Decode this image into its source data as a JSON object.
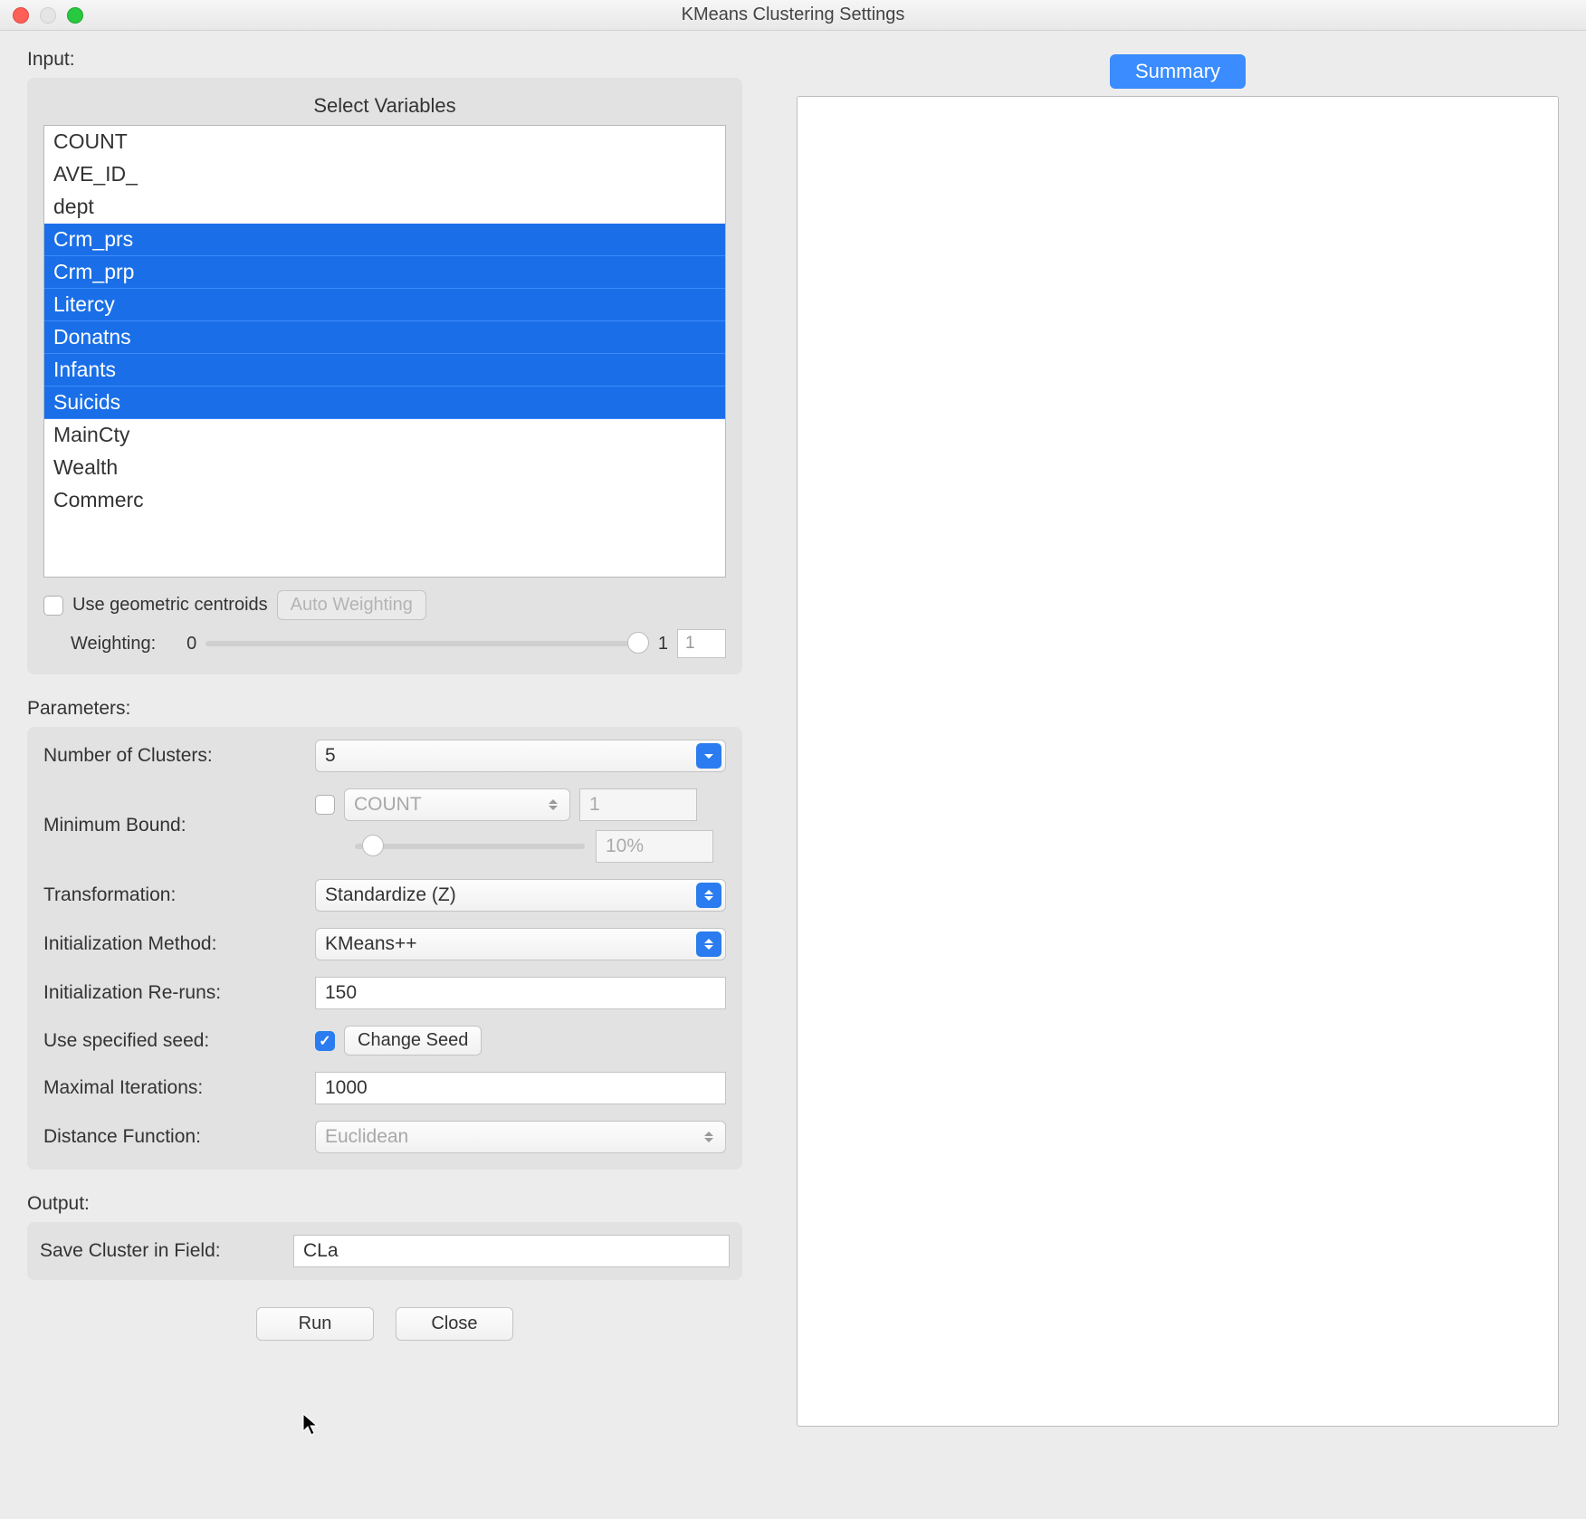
{
  "window": {
    "title": "KMeans Clustering Settings"
  },
  "input": {
    "section_label": "Input:",
    "select_header": "Select Variables",
    "variables": [
      {
        "name": "COUNT",
        "selected": false
      },
      {
        "name": "AVE_ID_",
        "selected": false
      },
      {
        "name": "dept",
        "selected": false
      },
      {
        "name": "Crm_prs",
        "selected": true
      },
      {
        "name": "Crm_prp",
        "selected": true
      },
      {
        "name": "Litercy",
        "selected": true
      },
      {
        "name": "Donatns",
        "selected": true
      },
      {
        "name": "Infants",
        "selected": true
      },
      {
        "name": "Suicids",
        "selected": true
      },
      {
        "name": "MainCty",
        "selected": false
      },
      {
        "name": "Wealth",
        "selected": false
      },
      {
        "name": "Commerc",
        "selected": false
      }
    ],
    "geometric_centroids": {
      "label": "Use geometric centroids",
      "checked": false
    },
    "auto_weighting": {
      "label": "Auto Weighting",
      "enabled": false
    },
    "weighting": {
      "label": "Weighting:",
      "min_label": "0",
      "max_label": "1",
      "value_display": "1"
    }
  },
  "parameters": {
    "section_label": "Parameters:",
    "number_of_clusters": {
      "label": "Number of Clusters:",
      "value": "5"
    },
    "minimum_bound": {
      "label": "Minimum Bound:",
      "checked": false,
      "field": "COUNT",
      "value": "1",
      "percent": "10%"
    },
    "transformation": {
      "label": "Transformation:",
      "value": "Standardize (Z)"
    },
    "init_method": {
      "label": "Initialization Method:",
      "value": "KMeans++"
    },
    "init_reruns": {
      "label": "Initialization Re-runs:",
      "value": "150"
    },
    "use_seed": {
      "label": "Use specified seed:",
      "checked": true,
      "change_seed": "Change Seed"
    },
    "max_iter": {
      "label": "Maximal Iterations:",
      "value": "1000"
    },
    "distance": {
      "label": "Distance Function:",
      "value": "Euclidean",
      "enabled": false
    }
  },
  "output": {
    "section_label": "Output:",
    "save_label": "Save Cluster in Field:",
    "save_value": "CLa"
  },
  "actions": {
    "run": "Run",
    "close": "Close"
  },
  "right": {
    "summary_tab": "Summary"
  }
}
